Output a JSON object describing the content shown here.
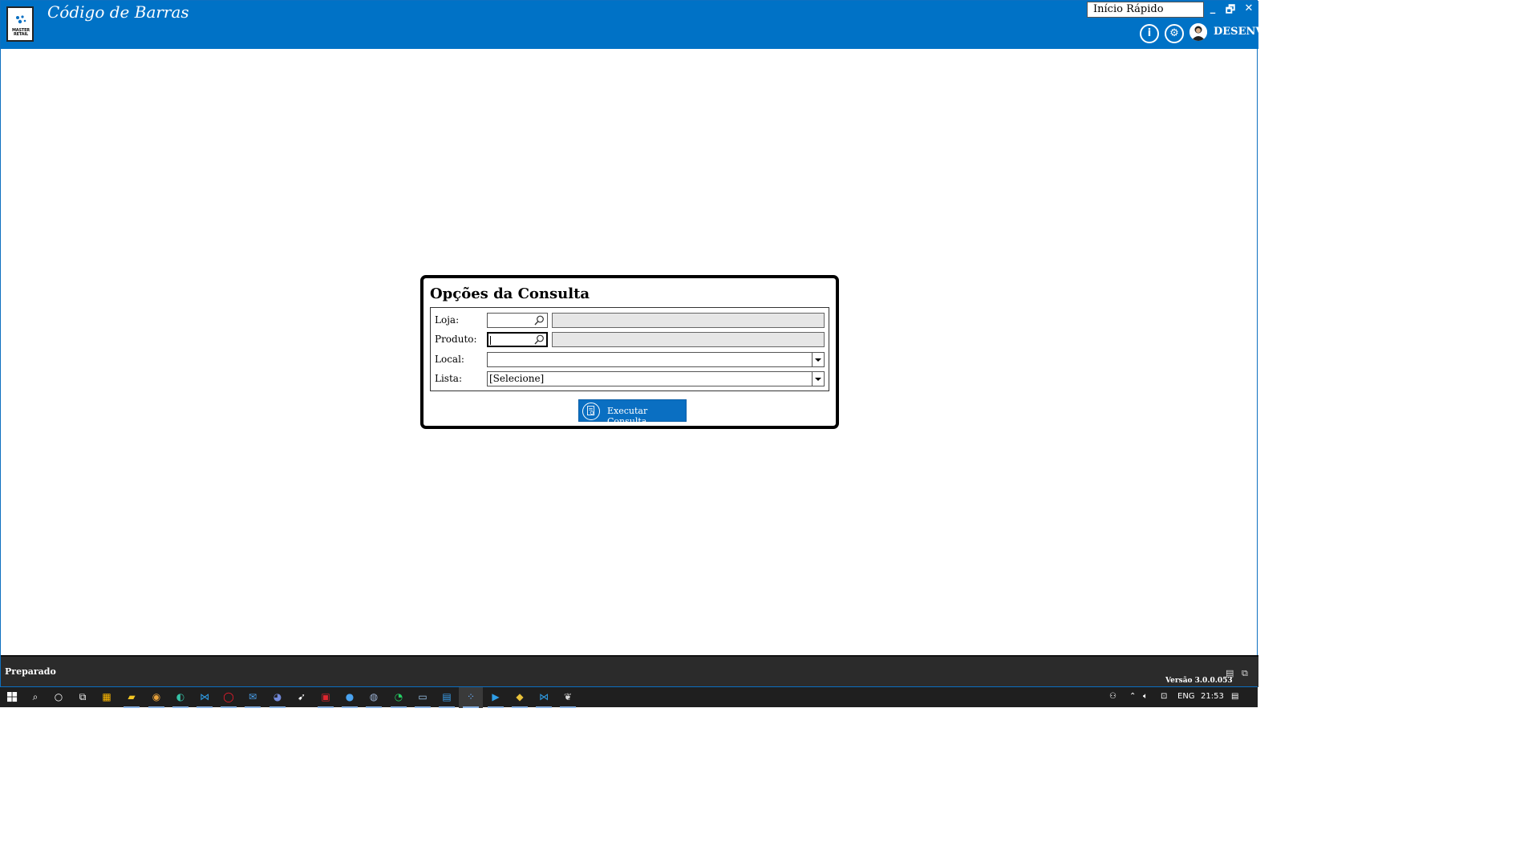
{
  "app": {
    "title": "Código de Barras",
    "logo_text": "MASTER RETAIL",
    "quick_start": "Início Rápido",
    "user": "DESENV",
    "window_buttons": {
      "minimize": "_",
      "restore": "🗗",
      "close": "✕"
    }
  },
  "form": {
    "title": "Opções da Consulta",
    "loja_label": "Loja:",
    "produto_label": "Produto:",
    "local_label": "Local:",
    "lista_label": "Lista:",
    "loja_code": "",
    "produto_code": "",
    "local_value": "",
    "lista_value": "[Selecione]",
    "execute_button": "Executar Consulta"
  },
  "status": {
    "text": "Preparado",
    "version": "Versão 3.0.0.053"
  },
  "taskbar": {
    "apps": [
      "start",
      "search",
      "cortana",
      "task-view",
      "store",
      "file-explorer",
      "chrome",
      "edge",
      "vscode",
      "opera",
      "mail",
      "discord",
      "cursor-app",
      "acrobat",
      "app-blue",
      "app-round",
      "whatsapp",
      "remote-desktop",
      "app-e",
      "master-retail",
      "app-media",
      "git-kraken",
      "vscode-2",
      "app-bird"
    ],
    "lang": "ENG",
    "time": "21:53"
  },
  "colors": {
    "titlebar": "#0072c6",
    "statusbar": "#2b2b2b",
    "taskbar": "#1f1f1f",
    "button": "#0a6fc2"
  }
}
